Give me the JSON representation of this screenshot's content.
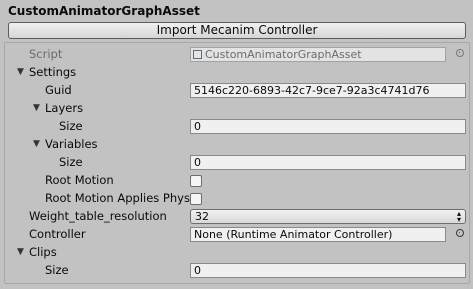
{
  "header": {
    "title": "CustomAnimatorGraphAsset",
    "import_button": "Import Mecanim Controller"
  },
  "inspector": {
    "script": {
      "label": "Script",
      "value": "CustomAnimatorGraphAsset"
    },
    "settings": {
      "label": "Settings",
      "guid": {
        "label": "Guid",
        "value": "5146c220-6893-42c7-9ce7-92a3c4741d76"
      },
      "layers": {
        "label": "Layers",
        "size_label": "Size",
        "size_value": "0"
      },
      "variables": {
        "label": "Variables",
        "size_label": "Size",
        "size_value": "0"
      },
      "root_motion": {
        "label": "Root Motion",
        "checked": false
      },
      "root_motion_applies_phys": {
        "label": "Root Motion Applies Phys",
        "checked": false
      }
    },
    "weight_table_resolution": {
      "label": "Weight_table_resolution",
      "value": "32"
    },
    "controller": {
      "label": "Controller",
      "value": "None (Runtime Animator Controller)"
    },
    "clips": {
      "label": "Clips",
      "size_label": "Size",
      "size_value": "0"
    }
  }
}
